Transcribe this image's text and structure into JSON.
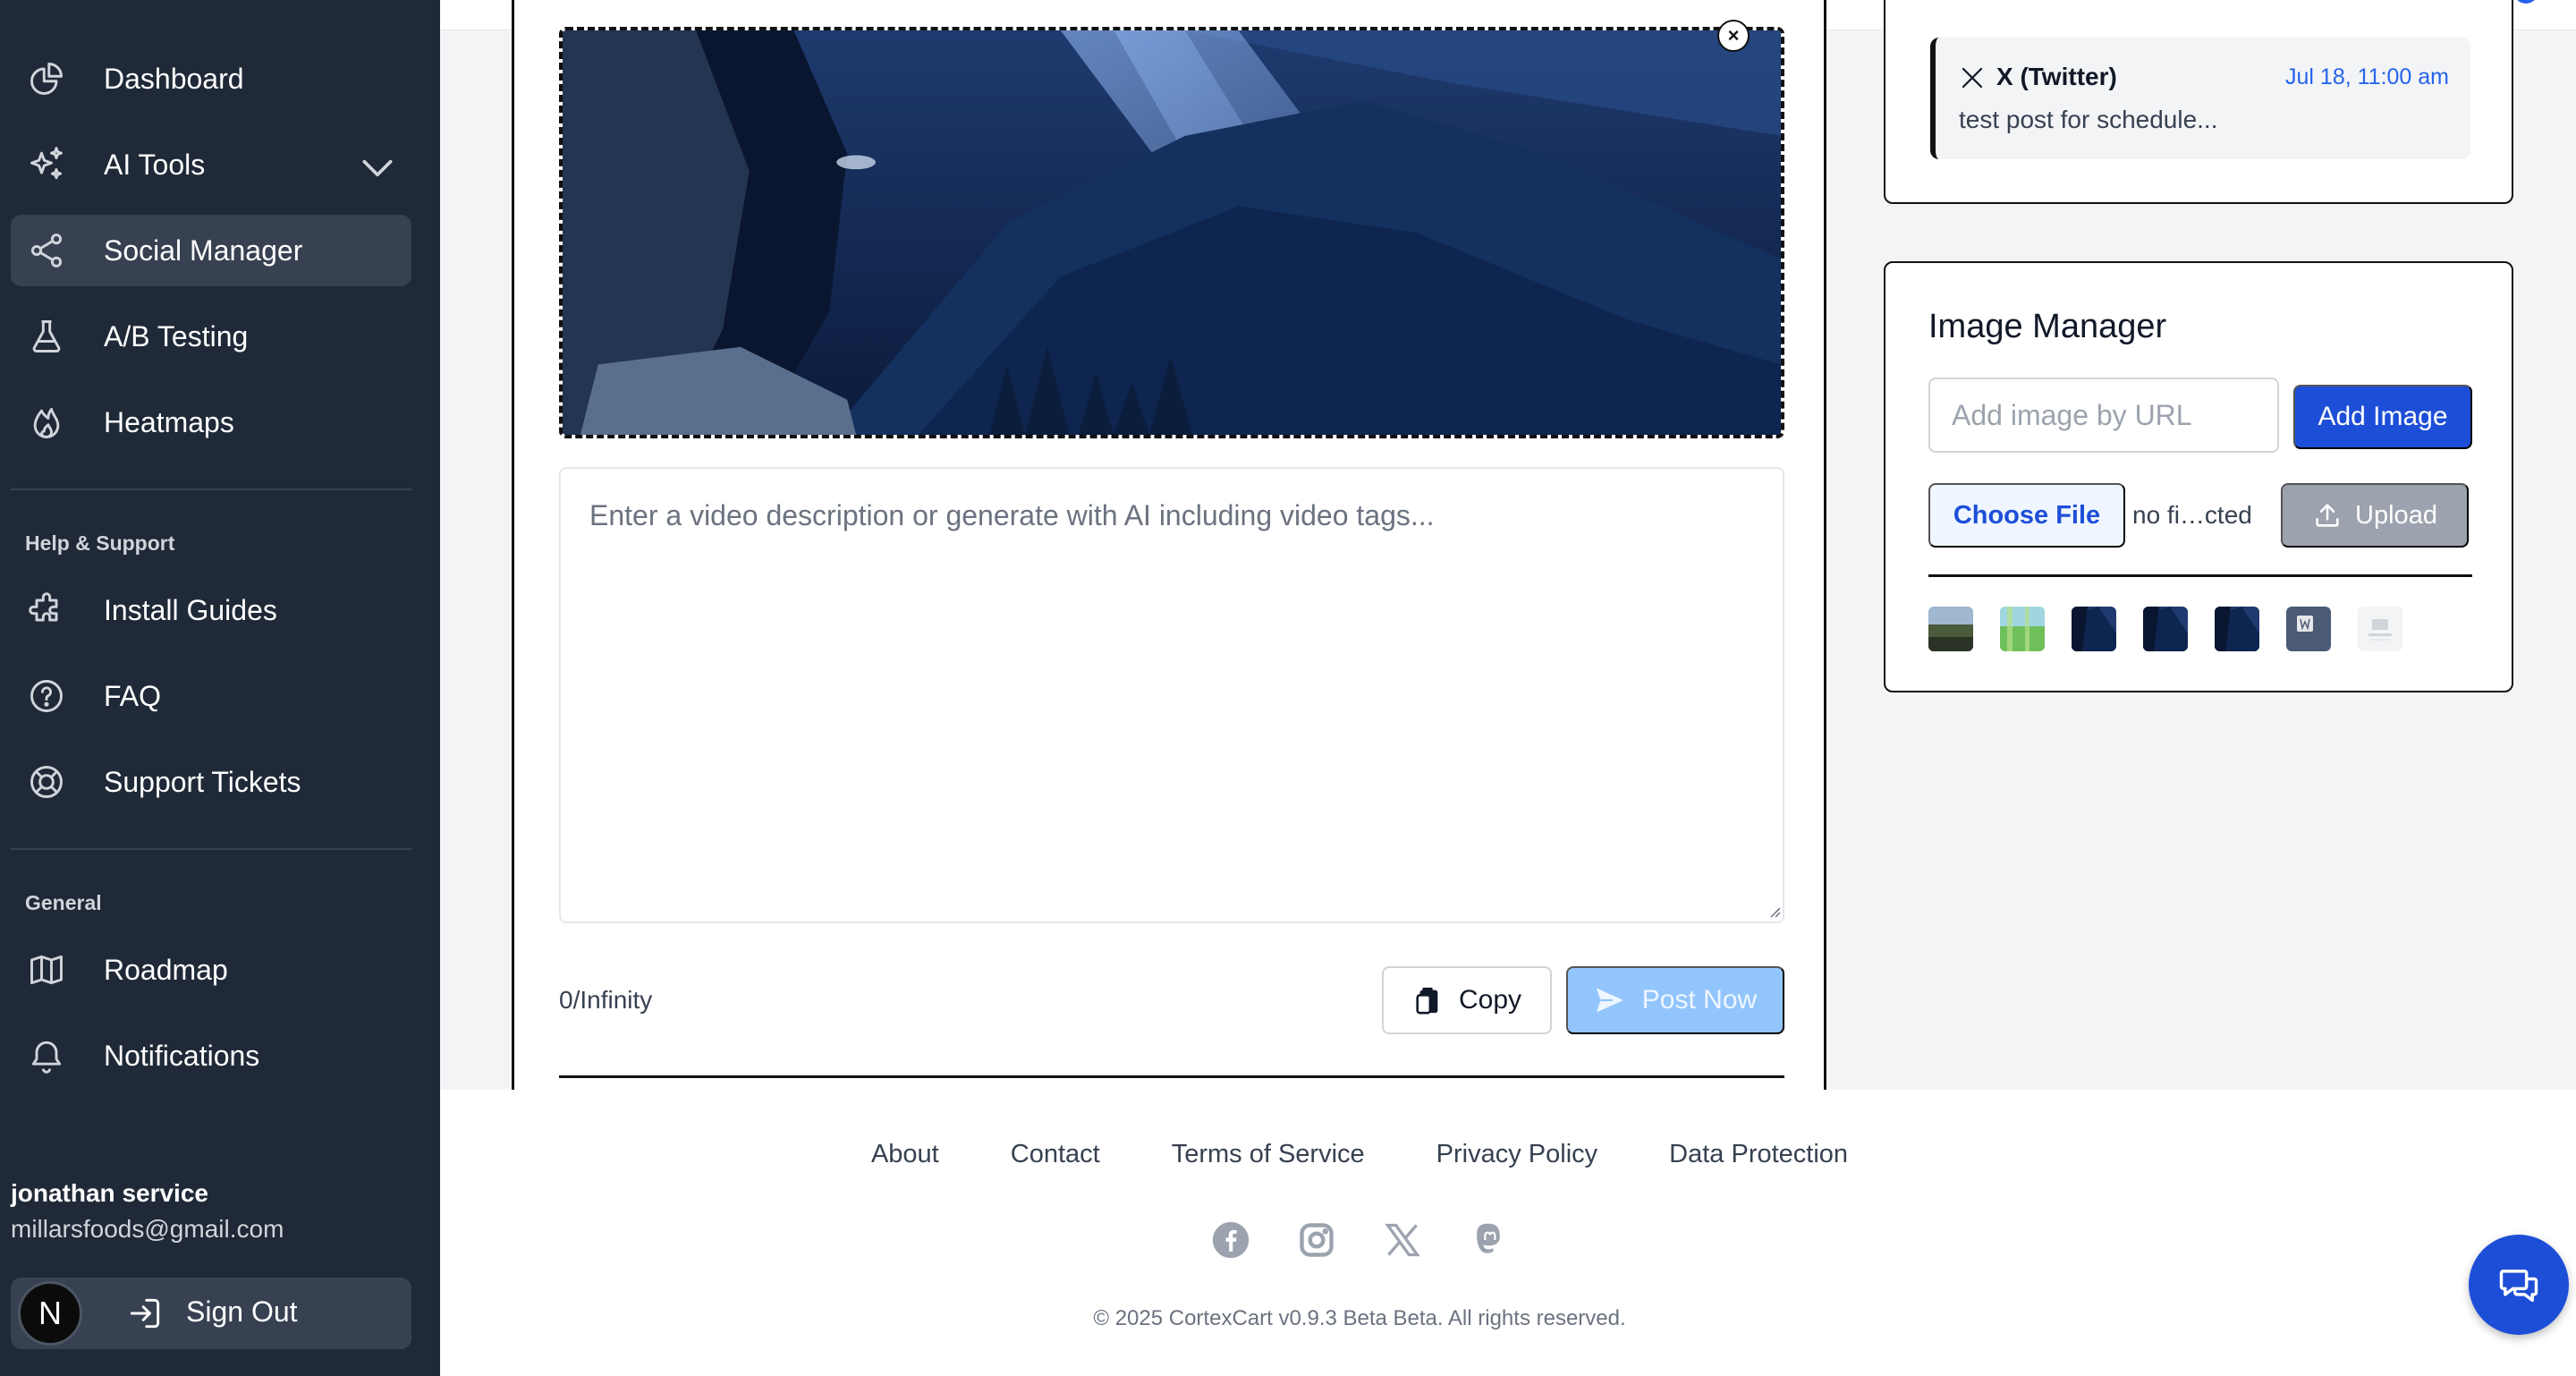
{
  "sidebar": {
    "items": [
      {
        "label": "Dashboard",
        "icon": "pie-chart-icon"
      },
      {
        "label": "AI Tools",
        "icon": "sparkles-icon"
      },
      {
        "label": "Social Manager",
        "icon": "share-icon",
        "active": true
      },
      {
        "label": "A/B Testing",
        "icon": "beaker-icon"
      },
      {
        "label": "Heatmaps",
        "icon": "flame-icon"
      }
    ],
    "help_heading": "Help & Support",
    "help_items": [
      {
        "label": "Install Guides",
        "icon": "puzzle-icon"
      },
      {
        "label": "FAQ",
        "icon": "question-icon"
      },
      {
        "label": "Support Tickets",
        "icon": "lifebuoy-icon"
      }
    ],
    "general_heading": "General",
    "general_items": [
      {
        "label": "Roadmap",
        "icon": "map-icon"
      },
      {
        "label": "Notifications",
        "icon": "bell-icon"
      }
    ],
    "user": {
      "name": "jonathan service",
      "email": "millarsfoods@gmail.com",
      "avatar_letter": "N"
    },
    "signout_label": "Sign Out"
  },
  "composer": {
    "remove_image_label": "×",
    "description_placeholder": "Enter a video description or generate with AI including video tags...",
    "description_value": "",
    "char_counter": "0/Infinity",
    "copy_label": "Copy",
    "post_now_label": "Post Now"
  },
  "scheduled": {
    "platform": "X (Twitter)",
    "time": "Jul 18, 11:00 am",
    "text": "test post for schedule..."
  },
  "image_manager": {
    "title": "Image Manager",
    "url_placeholder": "Add image by URL",
    "add_label": "Add Image",
    "choose_label": "Choose File",
    "no_file_text": "no fi…cted",
    "upload_label": "Upload"
  },
  "footer": {
    "links": [
      "About",
      "Contact",
      "Terms of Service",
      "Privacy Policy",
      "Data Protection"
    ],
    "socials": [
      "facebook-icon",
      "instagram-icon",
      "x-icon",
      "mastodon-icon"
    ],
    "copyright": "© 2025 CortexCart v0.9.3 Beta Beta. All rights reserved."
  },
  "colors": {
    "sidebar_bg": "#1f2937",
    "active_item": "#374151",
    "primary": "#1d4ed8",
    "post_disabled": "#93c5fd",
    "link_blue": "#2563eb"
  }
}
